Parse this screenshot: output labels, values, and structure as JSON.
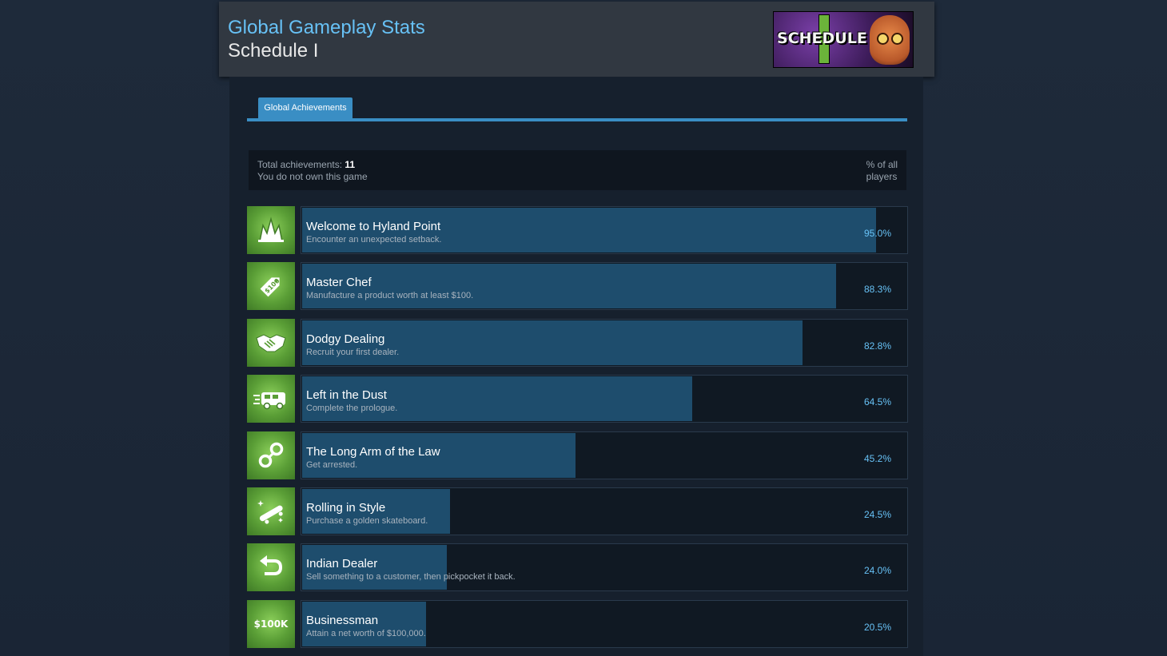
{
  "header": {
    "title": "Global Gameplay Stats",
    "subtitle": "Schedule I",
    "logo_text": "SCHEDULE",
    "title_color": "#67c1f5"
  },
  "tabs": [
    {
      "label": "Global Achievements",
      "active": true
    }
  ],
  "summary": {
    "total_label": "Total achievements: ",
    "total_count": "11",
    "ownership": "You do not own this game",
    "percent_header_line1": "% of all",
    "percent_header_line2": "players"
  },
  "achievements": [
    {
      "name": "Welcome to Hyland Point",
      "desc": "Encounter an unexpected setback.",
      "pct_text": "95.0%",
      "pct": 95.0,
      "icon": "explosion-icon"
    },
    {
      "name": "Master Chef",
      "desc": "Manufacture a product worth at least $100.",
      "pct_text": "88.3%",
      "pct": 88.3,
      "icon": "price-tag-icon"
    },
    {
      "name": "Dodgy Dealing",
      "desc": "Recruit your first dealer.",
      "pct_text": "82.8%",
      "pct": 82.8,
      "icon": "handshake-icon"
    },
    {
      "name": "Left in the Dust",
      "desc": "Complete the prologue.",
      "pct_text": "64.5%",
      "pct": 64.5,
      "icon": "van-icon"
    },
    {
      "name": "The Long Arm of the Law",
      "desc": "Get arrested.",
      "pct_text": "45.2%",
      "pct": 45.2,
      "icon": "handcuffs-icon"
    },
    {
      "name": "Rolling in Style",
      "desc": "Purchase a golden skateboard.",
      "pct_text": "24.5%",
      "pct": 24.5,
      "icon": "skateboard-icon"
    },
    {
      "name": "Indian Dealer",
      "desc": "Sell something to a customer, then pickpocket it back.",
      "pct_text": "24.0%",
      "pct": 24.0,
      "icon": "return-arrow-icon"
    },
    {
      "name": "Businessman",
      "desc": "Attain a net worth of $100,000.",
      "pct_text": "20.5%",
      "pct": 20.5,
      "icon": "money-100k-icon",
      "icon_text": "$100K"
    }
  ]
}
